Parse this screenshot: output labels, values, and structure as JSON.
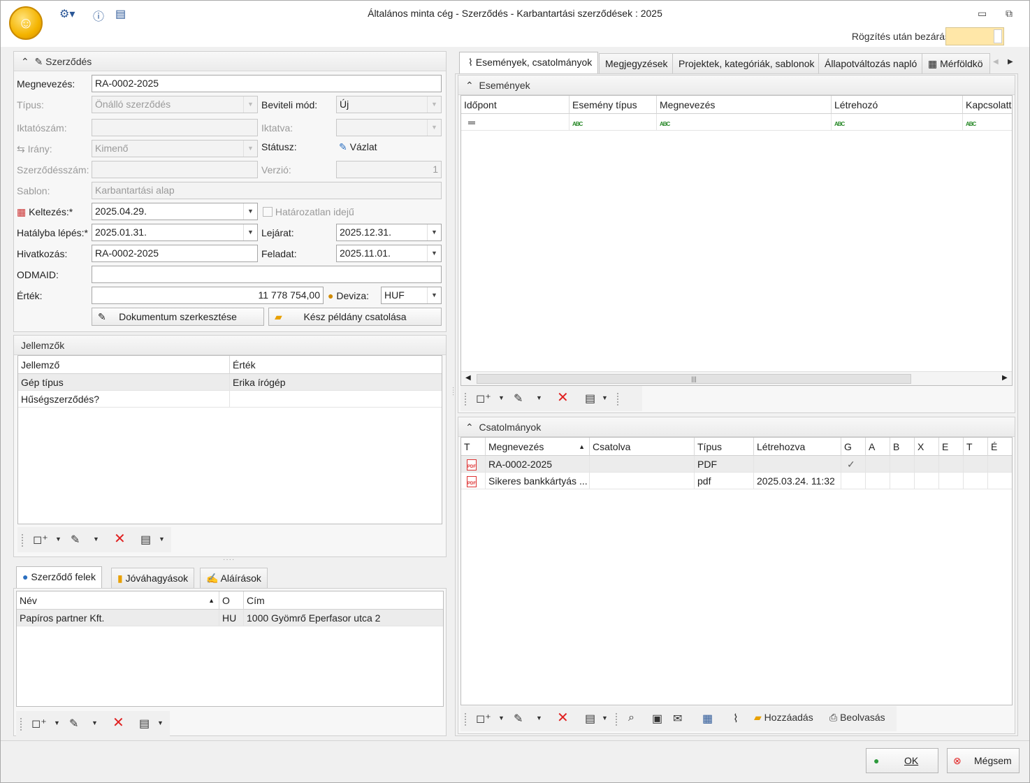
{
  "window": {
    "title": "Általános minta cég - Szerződés - Karbantartási szerződések : 2025",
    "close_after_save_label": "Rögzítés után bezárás"
  },
  "contract": {
    "header": "Szerződés",
    "labels": {
      "name": "Megnevezés:",
      "type": "Típus:",
      "entry_mode": "Beviteli mód:",
      "file_no": "Iktatószám:",
      "filed": "Iktatva:",
      "direction": "Irány:",
      "status": "Státusz:",
      "contract_no": "Szerződésszám:",
      "version": "Verzió:",
      "template": "Sablon:",
      "dated": "Keltezés:*",
      "indefinite": "Határozatlan idejű",
      "effective": "Hatályba lépés:*",
      "expiry": "Lejárat:",
      "reference": "Hivatkozás:",
      "task": "Feladat:",
      "odmaid": "ODMAID:",
      "value": "Érték:",
      "currency": "Deviza:"
    },
    "values": {
      "name": "RA-0002-2025",
      "type": "Önálló szerződés",
      "entry_mode": "Új",
      "file_no": "",
      "filed": "",
      "direction": "Kimenő",
      "status": "Vázlat",
      "contract_no": "",
      "version": "1",
      "template": "Karbantartási alap",
      "dated": "2025.04.29.",
      "effective": "2025.01.31.",
      "expiry": "2025.12.31.",
      "reference": "RA-0002-2025",
      "task": "2025.11.01.",
      "odmaid": "",
      "value": "11 778 754,00",
      "currency": "HUF"
    },
    "buttons": {
      "edit_doc": "Dokumentum szerkesztése",
      "attach": "Kész példány csatolása"
    }
  },
  "properties": {
    "header": "Jellemzők",
    "columns": [
      "Jellemző",
      "Érték"
    ],
    "rows": [
      [
        "Gép típus",
        "Erika írógép"
      ],
      [
        "Hűségszerződés?",
        ""
      ]
    ]
  },
  "parties": {
    "tabs": [
      "Szerződő felek",
      "Jóváhagyások",
      "Aláírások"
    ],
    "columns": [
      "Név",
      "O",
      "Cím"
    ],
    "rows": [
      [
        "Papíros partner Kft.",
        "HU",
        "1000 Gyömrő Eperfasor utca 2"
      ]
    ]
  },
  "right_tabs": [
    "Események, csatolmányok",
    "Megjegyzések",
    "Projektek, kategóriák, sablonok",
    "Állapotváltozás napló",
    "Mérföldkö"
  ],
  "events": {
    "header": "Események",
    "columns": [
      "Időpont",
      "Esemény típus",
      "Megnevezés",
      "Létrehozó",
      "Kapcsolatta"
    ]
  },
  "attachments": {
    "header": "Csatolmányok",
    "columns": [
      "T",
      "Megnevezés",
      "Csatolva",
      "Típus",
      "Létrehozva",
      "G",
      "A",
      "B",
      "X",
      "E",
      "T",
      "É"
    ],
    "rows": [
      {
        "name": "RA-0002-2025",
        "attached": "",
        "type": "PDF",
        "created": ""
      },
      {
        "name": "Sikeres bankkártyás ...",
        "attached": "",
        "type": "pdf",
        "created": "2025.03.24. 11:32"
      }
    ],
    "toolbar": {
      "add": "Hozzáadás",
      "scan": "Beolvasás"
    }
  },
  "footer": {
    "ok": "OK",
    "cancel": "Mégsem"
  }
}
